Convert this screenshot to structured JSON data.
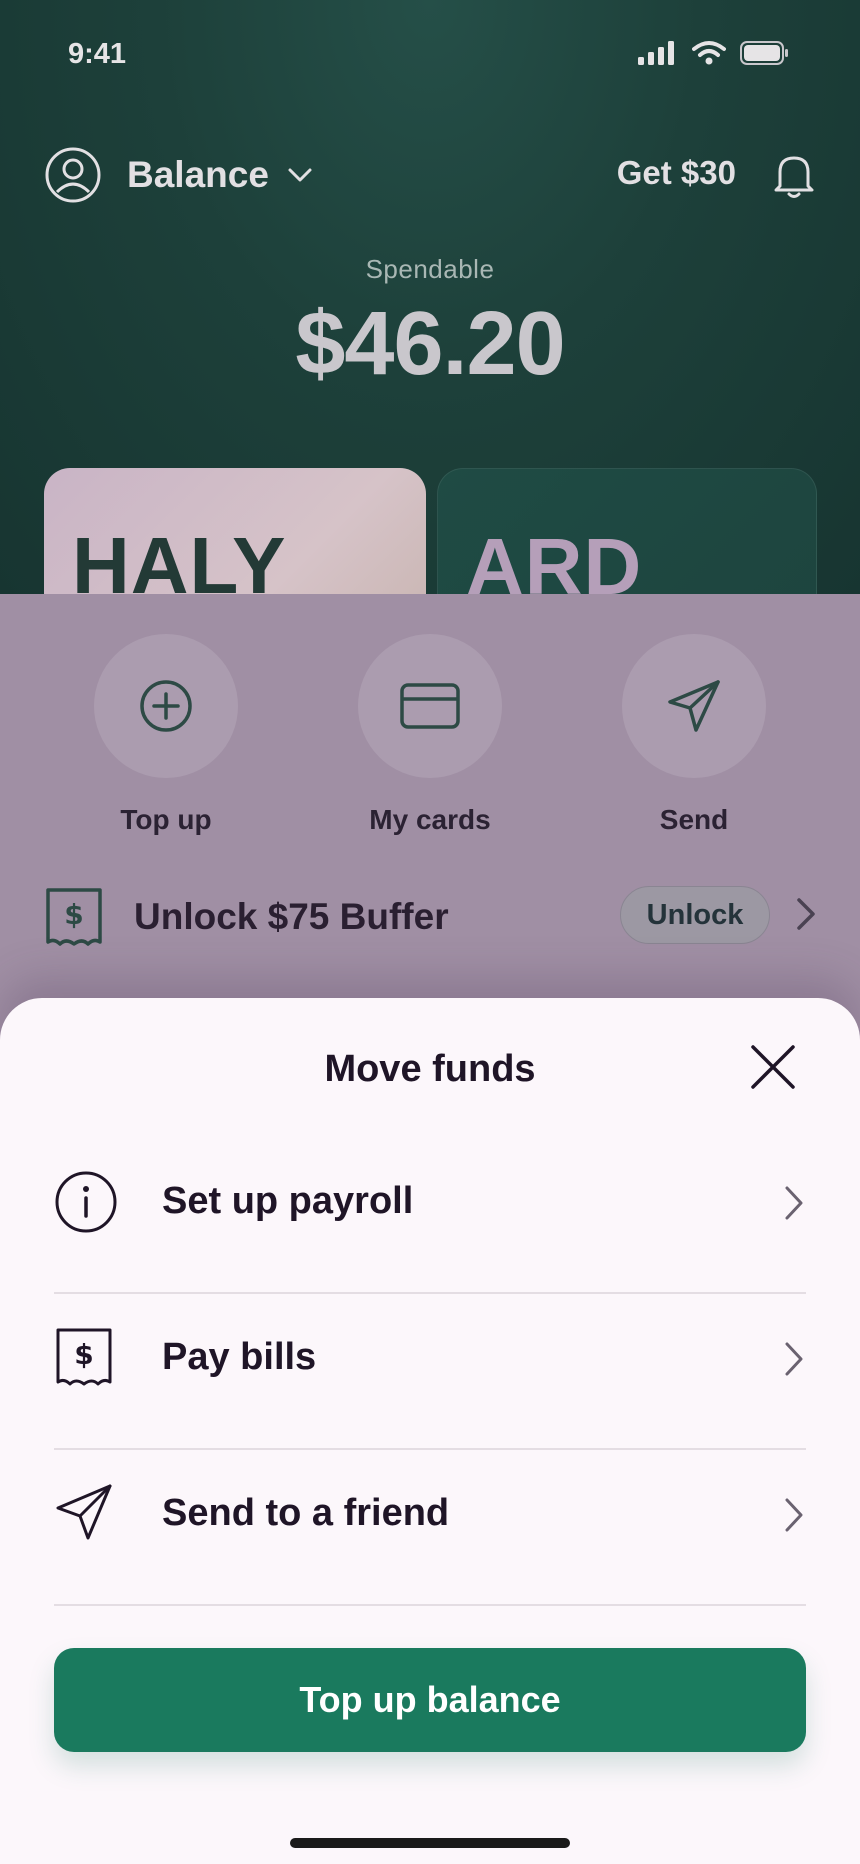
{
  "status_bar": {
    "time": "9:41"
  },
  "header": {
    "account": "Balance",
    "referral": "Get $30"
  },
  "balance": {
    "label": "Spendable",
    "amount": "$46.20"
  },
  "cards": [
    {
      "label": "HALY"
    },
    {
      "label": "ARD"
    }
  ],
  "actions": [
    {
      "label": "Top up",
      "icon": "plus-circle-icon"
    },
    {
      "label": "My cards",
      "icon": "card-icon"
    },
    {
      "label": "Send",
      "icon": "send-icon"
    }
  ],
  "buffer": {
    "text": "Unlock $75 Buffer",
    "button": "Unlock"
  },
  "sheet": {
    "title": "Move funds",
    "options": [
      {
        "label": "Set up payroll",
        "icon": "info-icon"
      },
      {
        "label": "Pay bills",
        "icon": "bill-icon"
      },
      {
        "label": "Send to a friend",
        "icon": "send-icon"
      }
    ],
    "primary_button": "Top up balance"
  },
  "colors": {
    "top_background": "#1d403a",
    "dim_overlay": "#a08fa4",
    "sheet_background": "#fcf7fb",
    "primary": "#1a7a5e",
    "text_dark": "#1f1527"
  }
}
